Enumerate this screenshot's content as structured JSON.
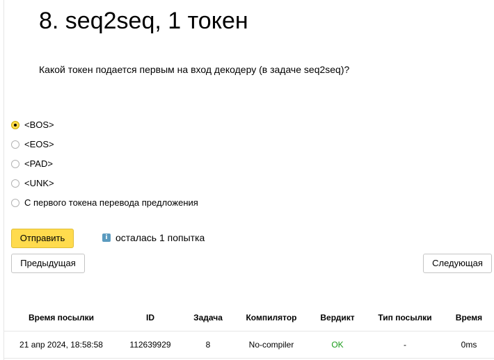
{
  "title": "8. seq2seq, 1 токен",
  "question": "Какой токен подается первым на вход декодеру (в задаче seq2seq)?",
  "options": [
    {
      "label": "<BOS>",
      "checked": true
    },
    {
      "label": "<EOS>",
      "checked": false
    },
    {
      "label": "<PAD>",
      "checked": false
    },
    {
      "label": "<UNK>",
      "checked": false
    },
    {
      "label": "С первого токена перевода предложения",
      "checked": false
    }
  ],
  "submit_label": "Отправить",
  "attempts": {
    "icon": "info-icon",
    "text": "осталась 1 попытка"
  },
  "nav": {
    "prev_label": "Предыдущая",
    "next_label": "Следующая"
  },
  "table": {
    "headers": [
      "Время посылки",
      "ID",
      "Задача",
      "Компилятор",
      "Вердикт",
      "Тип посылки",
      "Время"
    ],
    "rows": [
      [
        "21 апр 2024, 18:58:58",
        "112639929",
        "8",
        "No-compiler",
        "OK",
        "-",
        "0ms"
      ]
    ]
  },
  "colors": {
    "accent": "#ffdb4d",
    "ok": "#1a9b1a",
    "info": "#5b9bbf"
  }
}
